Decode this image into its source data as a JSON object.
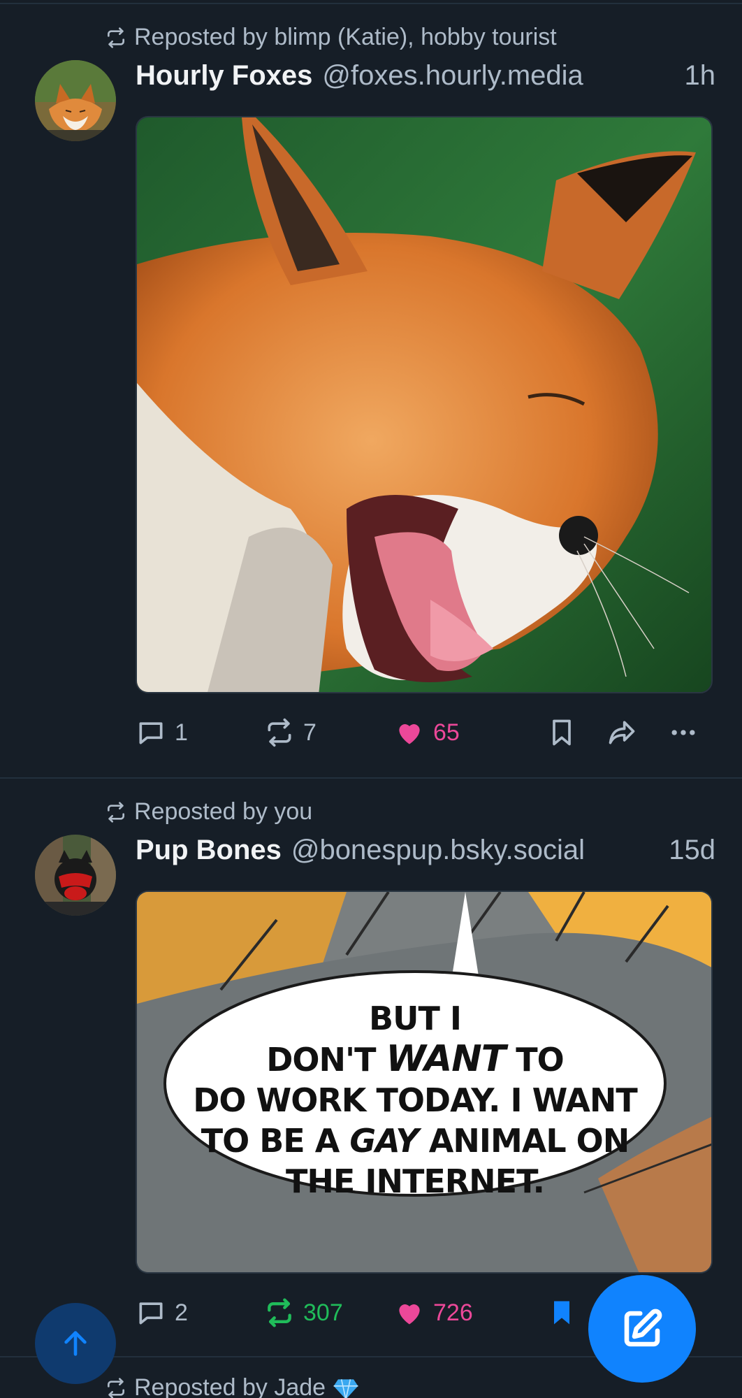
{
  "colors": {
    "background": "#161e27",
    "muted": "#aebbc9",
    "like": "#ec4899",
    "repost": "#20bc5a",
    "accent": "#1083fe"
  },
  "posts": [
    {
      "repost_text": "Reposted by blimp (Katie), hobby tourist",
      "display_name": "Hourly Foxes",
      "handle": "@foxes.hourly.media",
      "time": "1h",
      "media_alt": "",
      "replies": "1",
      "reposts": "7",
      "likes": "65",
      "liked": true,
      "reposted": false,
      "bookmarked": false
    },
    {
      "repost_text": "Reposted by you",
      "display_name": "Pup Bones",
      "handle": "@bonespup.bsky.social",
      "time": "15d",
      "media_text": {
        "line1": "BUT I",
        "line2a": "DON'T ",
        "line2b": "WANT",
        "line2c": " TO",
        "line3": "DO WORK TODAY. I WANT",
        "line4a": "TO BE A ",
        "line4b": "GAY",
        "line4c": " ANIMAL ON",
        "line5": "THE INTERNET."
      },
      "replies": "2",
      "reposts": "307",
      "likes": "726",
      "liked": true,
      "reposted": true,
      "bookmarked": true
    }
  ],
  "next_repost_text": "Reposted by Jade",
  "next_repost_emoji": "gem-icon",
  "icons": {
    "repost": "repost-icon",
    "reply": "reply-icon",
    "like": "heart-icon",
    "bookmark": "bookmark-icon",
    "share": "share-icon",
    "more": "more-icon",
    "compose": "compose-icon",
    "scroll_top": "arrow-up-icon"
  }
}
